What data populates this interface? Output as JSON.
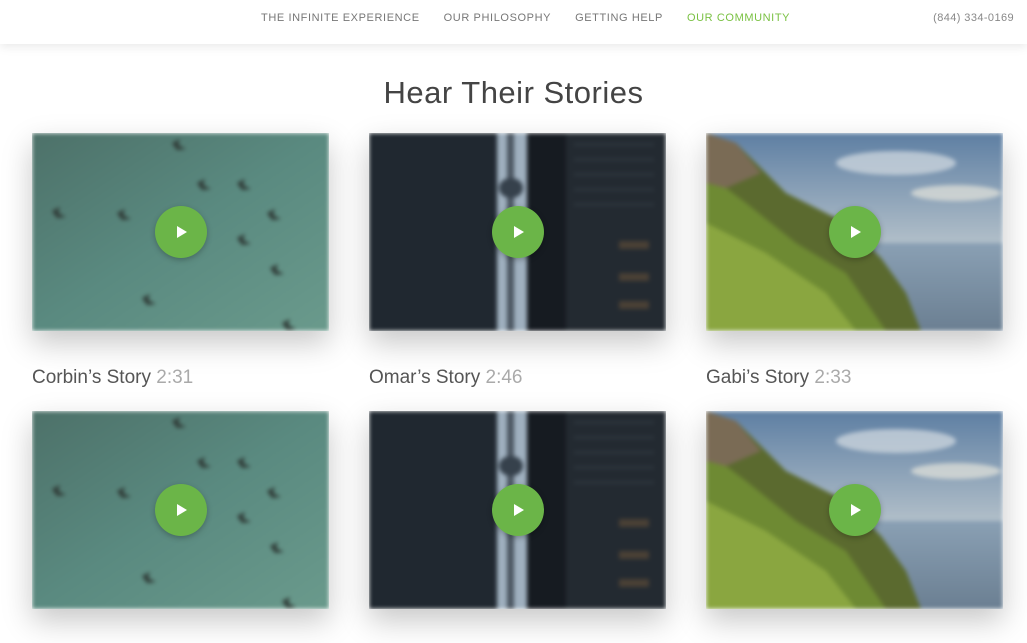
{
  "nav": {
    "items": [
      {
        "label": "THE INFINITE EXPERIENCE",
        "active": false
      },
      {
        "label": "OUR PHILOSOPHY",
        "active": false
      },
      {
        "label": "GETTING HELP",
        "active": false
      },
      {
        "label": "OUR COMMUNITY",
        "active": true
      }
    ],
    "phone": "(844) 334-0169"
  },
  "section": {
    "title": "Hear Their Stories"
  },
  "stories": [
    {
      "name": "Corbin’s Story",
      "duration": "2:31",
      "scene": "birds-over-water"
    },
    {
      "name": "Omar’s Story",
      "duration": "2:46",
      "scene": "city-tower"
    },
    {
      "name": "Gabi’s Story",
      "duration": "2:33",
      "scene": "coastal-cliff"
    }
  ],
  "colors": {
    "accent": "#7ac143",
    "play_button": "#6bb548"
  },
  "icons": {
    "play": "play-icon"
  }
}
